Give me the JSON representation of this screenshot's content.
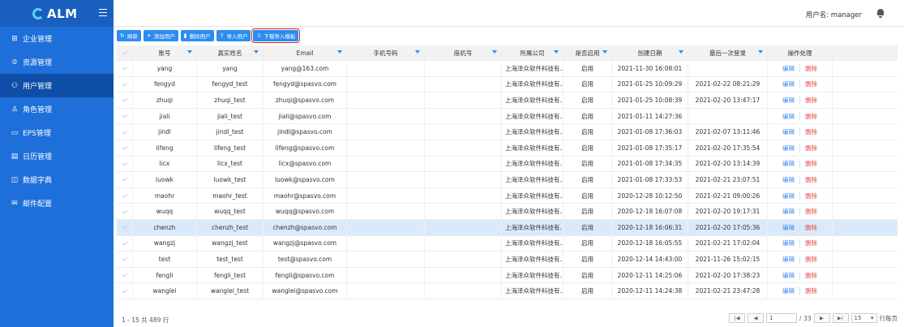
{
  "app": {
    "logo": "ALM"
  },
  "sidebar": {
    "items": [
      {
        "icon": "⊞",
        "label": "企业管理"
      },
      {
        "icon": "♔",
        "label": "资源管理"
      },
      {
        "icon": "⚇",
        "label": "用户管理"
      },
      {
        "icon": "♙",
        "label": "角色管理"
      },
      {
        "icon": "▭",
        "label": "EPS管理"
      },
      {
        "icon": "▤",
        "label": "日历管理"
      },
      {
        "icon": "◫",
        "label": "数据字典"
      },
      {
        "icon": "✉",
        "label": "邮件配置"
      }
    ],
    "active": 2
  },
  "header": {
    "user": "用户名: manager"
  },
  "toolbar": {
    "refresh": "刷新",
    "add": "添加用户",
    "delete": "删除用户",
    "import": "导入用户",
    "download": "下载导入模板"
  },
  "table": {
    "headers": [
      "账号",
      "真实姓名",
      "Email",
      "手机号码",
      "座机号",
      "所属公司",
      "是否启用",
      "创建日期",
      "最后一次登录",
      "操作处理"
    ],
    "rows": [
      [
        "yang",
        "yang",
        "yang@163.com",
        "",
        "",
        "上海泽众软件科技有...",
        "启用",
        "2021-11-30 16:08:01",
        ""
      ],
      [
        "fengyd",
        "fengyd_test",
        "fengyd@spasvo.com",
        "",
        "",
        "上海泽众软件科技有...",
        "启用",
        "2021-01-25 10:09:29",
        "2021-02-22 08:21:29"
      ],
      [
        "zhuqi",
        "zhuqi_test",
        "zhuqi@spasvo.com",
        "",
        "",
        "上海泽众软件科技有...",
        "启用",
        "2021-01-25 10:08:39",
        "2021-02-20 13:47:17"
      ],
      [
        "jiali",
        "jiali_test",
        "jiali@spasvo.com",
        "",
        "",
        "上海泽众软件科技有...",
        "启用",
        "2021-01-11 14:27:36",
        ""
      ],
      [
        "jindl",
        "jindl_test",
        "jindl@spasvo.com",
        "",
        "",
        "上海泽众软件科技有...",
        "启用",
        "2021-01-08 17:36:03",
        "2021-02-07 13:11:46"
      ],
      [
        "lifeng",
        "lifeng_test",
        "lifeng@spasvo.com",
        "",
        "",
        "上海泽众软件科技有...",
        "启用",
        "2021-01-08 17:35:17",
        "2021-02-20 17:35:54"
      ],
      [
        "licx",
        "licx_test",
        "licx@spasvo.com",
        "",
        "",
        "上海泽众软件科技有...",
        "启用",
        "2021-01-08 17:34:35",
        "2021-02-20 13:14:39"
      ],
      [
        "luowk",
        "luowk_test",
        "luowk@spasvo.com",
        "",
        "",
        "上海泽众软件科技有...",
        "启用",
        "2021-01-08 17:33:53",
        "2021-02-21 23:07:51"
      ],
      [
        "maohr",
        "maohr_test",
        "maohr@spasvo.com",
        "",
        "",
        "上海泽众软件科技有...",
        "启用",
        "2020-12-28 10:12:50",
        "2021-02-21 09:00:26"
      ],
      [
        "wuqq",
        "wuqq_test",
        "wuqq@spasvo.com",
        "",
        "",
        "上海泽众软件科技有...",
        "启用",
        "2020-12-18 16:07:08",
        "2021-02-20 19:17:31"
      ],
      [
        "chenzh",
        "chenzh_test",
        "chenzh@spasvo.com",
        "",
        "",
        "上海泽众软件科技有...",
        "启用",
        "2020-12-18 16:06:31",
        "2021-02-20 17:05:36"
      ],
      [
        "wangzj",
        "wangzj_test",
        "wangzj@spasvo.com",
        "",
        "",
        "上海泽众软件科技有...",
        "启用",
        "2020-12-18 16:05:55",
        "2021-02-21 17:02:04"
      ],
      [
        "test",
        "test_test",
        "test@spasvo.com",
        "",
        "",
        "上海泽众软件科技有...",
        "启用",
        "2020-12-14 14:43:00",
        "2021-11-26 15:02:15"
      ],
      [
        "fengli",
        "fengli_test",
        "fengli@spasvo.com",
        "",
        "",
        "上海泽众软件科技有...",
        "启用",
        "2020-12-11 14:25:06",
        "2021-02-20 17:38:23"
      ],
      [
        "wanglei",
        "wanglei_test",
        "wanglei@spasvo.com",
        "",
        "",
        "上海泽众软件科技有...",
        "启用",
        "2020-12-11 14:24:38",
        "2021-02-21 23:47:28"
      ]
    ],
    "selected_row": 10,
    "edit_label": "编辑",
    "delete_label": "删除"
  },
  "footer": {
    "info": "1 - 15 共 489 行",
    "page_value": "1",
    "page_total": "/ 33",
    "page_size": "15",
    "page_size_suffix": "行每页"
  },
  "colors": {
    "sidebar": "#1e6fd9",
    "primary": "#2d8cf0",
    "danger": "#e54d42",
    "selected_row": "#dbeafb"
  }
}
